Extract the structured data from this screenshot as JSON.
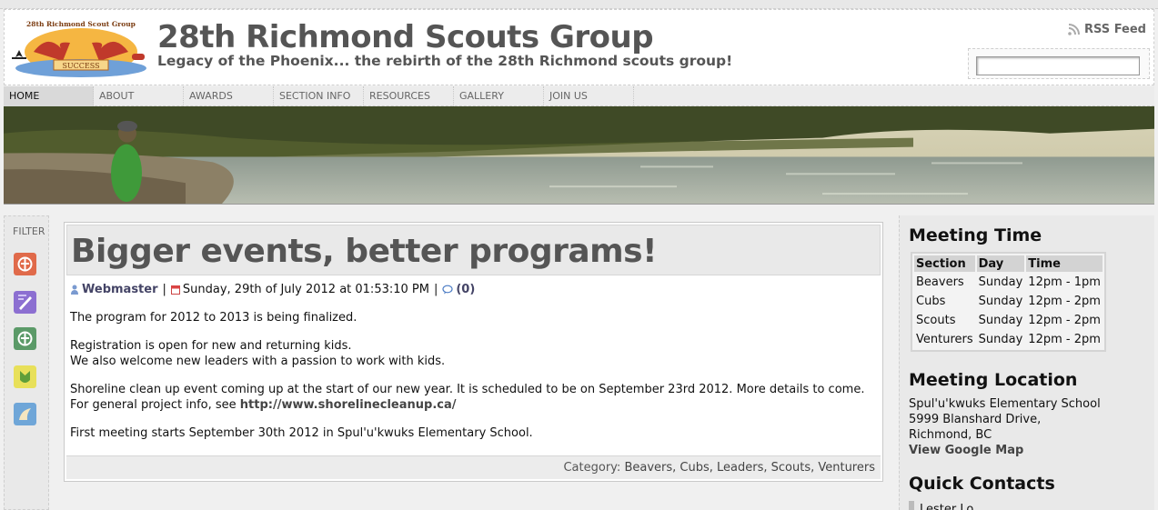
{
  "site": {
    "title": "28th Richmond Scouts Group",
    "tagline": "Legacy of the Phoenix... the rebirth of the 28th Richmond scouts group!",
    "logo_text": "28th Richmond Scout Group",
    "logo_banner": "SUCCESS",
    "rss_label": "RSS Feed",
    "search_value": ""
  },
  "nav": {
    "items": [
      {
        "label": "HOME",
        "active": true
      },
      {
        "label": "ABOUT",
        "active": false
      },
      {
        "label": "AWARDS",
        "active": false
      },
      {
        "label": "SECTION INFO",
        "active": false
      },
      {
        "label": "RESOURCES",
        "active": false
      },
      {
        "label": "GALLERY",
        "active": false
      },
      {
        "label": "JOIN US",
        "active": false
      }
    ]
  },
  "filter": {
    "label": "FILTER",
    "icons": [
      {
        "name": "scouts-fleur-icon",
        "color": "#e06a4a"
      },
      {
        "name": "leaders-pen-icon",
        "color": "#8c6fd1"
      },
      {
        "name": "cubs-fleur-icon",
        "color": "#5b9a68"
      },
      {
        "name": "beavers-icon",
        "color": "#e8e05a"
      },
      {
        "name": "venturers-icon",
        "color": "#6fa6d8"
      }
    ]
  },
  "post": {
    "title": "Bigger events, better programs!",
    "author": "Webmaster",
    "date": "Sunday, 29th of July 2012 at 01:53:10 PM",
    "comments": "(0)",
    "para1": "The program for 2012 to 2013 is being finalized.",
    "para2_line1": "Registration is open for new and returning kids.",
    "para2_line2": "We also welcome new leaders with a passion to work with kids.",
    "para3_text": "Shoreline clean up event coming up at the start of our new year. It is scheduled to be on September 23rd 2012. More details to come. For general project info, see",
    "para3_link": "http://www.shorelinecleanup.ca/",
    "para4": "First meeting starts September 30th 2012 in Spul'u'kwuks Elementary School.",
    "category_label": "Category:",
    "categories": "Beavers, Cubs, Leaders, Scouts, Venturers"
  },
  "sidebar": {
    "meeting_time": {
      "heading": "Meeting Time",
      "headers": [
        "Section",
        "Day",
        "Time"
      ],
      "rows": [
        [
          "Beavers",
          "Sunday",
          "12pm - 1pm"
        ],
        [
          "Cubs",
          "Sunday",
          "12pm - 2pm"
        ],
        [
          "Scouts",
          "Sunday",
          "12pm - 2pm"
        ],
        [
          "Venturers",
          "Sunday",
          "12pm - 2pm"
        ]
      ]
    },
    "meeting_location": {
      "heading": "Meeting Location",
      "line1": "Spul'u'kwuks Elementary School",
      "line2": "5999 Blanshard Drive,",
      "line3": "Richmond, BC",
      "map_link": "View Google Map"
    },
    "quick_contacts": {
      "heading": "Quick Contacts",
      "first_contact": "Lester Lo"
    }
  }
}
